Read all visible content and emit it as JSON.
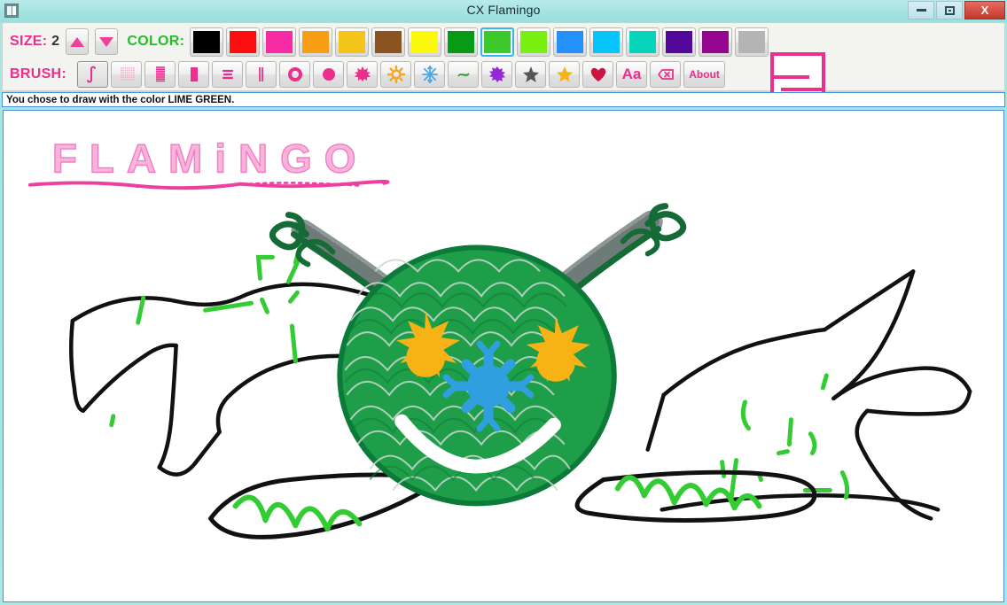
{
  "window": {
    "title": "CX Flamingo",
    "icon": "app-icon",
    "minimize_label": "",
    "maximize_label": "",
    "close_label": "X"
  },
  "toolbar": {
    "size_label": "SIZE:",
    "size_value": "2",
    "size_up_label": "",
    "size_down_label": "",
    "color_label": "COLOR:",
    "brush_label": "BRUSH:",
    "about_label": "About",
    "text_brush_label": "Aa",
    "selected_color_index": 8,
    "selected_brush_index": 0,
    "colors": [
      {
        "name": "black",
        "hex": "#000000"
      },
      {
        "name": "red",
        "hex": "#fb0f0f"
      },
      {
        "name": "pink",
        "hex": "#f72ba4"
      },
      {
        "name": "orange",
        "hex": "#f79e12"
      },
      {
        "name": "gold",
        "hex": "#f5c41b"
      },
      {
        "name": "brown",
        "hex": "#8c5322"
      },
      {
        "name": "yellow",
        "hex": "#faf80d"
      },
      {
        "name": "dark-green",
        "hex": "#069a15"
      },
      {
        "name": "lime-green",
        "hex": "#3cc92c"
      },
      {
        "name": "bright-green",
        "hex": "#79ef12"
      },
      {
        "name": "blue",
        "hex": "#2490fb"
      },
      {
        "name": "sky-blue",
        "hex": "#09c4fb"
      },
      {
        "name": "turquoise",
        "hex": "#08d3bb"
      },
      {
        "name": "purple",
        "hex": "#520898"
      },
      {
        "name": "magenta",
        "hex": "#96068f"
      },
      {
        "name": "gray",
        "hex": "#b4b4b4"
      }
    ],
    "brushes": [
      {
        "name": "integral-curve-brush",
        "icon": "integral-icon"
      },
      {
        "name": "dotted-sketch-brush",
        "icon": "dotted-icon"
      },
      {
        "name": "dense-hatch-brush",
        "icon": "hatch-icon"
      },
      {
        "name": "solid-block-brush",
        "icon": "block-icon"
      },
      {
        "name": "triple-line-brush",
        "icon": "lines-icon"
      },
      {
        "name": "parallel-line-brush",
        "icon": "parallel-icon"
      },
      {
        "name": "circle-outline-brush",
        "icon": "circle-outline-icon"
      },
      {
        "name": "filled-circle-brush",
        "icon": "filled-circle-icon"
      },
      {
        "name": "burst-brush",
        "icon": "burst-icon"
      },
      {
        "name": "sun-brush",
        "icon": "sun-icon"
      },
      {
        "name": "snowflake-brush",
        "icon": "snowflake-icon"
      },
      {
        "name": "swirl-brush",
        "icon": "swirl-icon"
      },
      {
        "name": "flower-brush",
        "icon": "flower-icon"
      },
      {
        "name": "star-gray-brush",
        "icon": "star-icon"
      },
      {
        "name": "star-gold-brush",
        "icon": "star-filled-icon"
      },
      {
        "name": "heart-brush",
        "icon": "heart-icon"
      },
      {
        "name": "text-brush",
        "icon": "text-icon"
      },
      {
        "name": "eraser-brush",
        "icon": "eraser-icon"
      }
    ]
  },
  "status": {
    "message": "You chose to draw with the color LIME GREEN."
  },
  "canvas": {
    "title_text": "FLAMINGO",
    "title_color": "#f7a8d8",
    "underline_color": "#ec3f9e",
    "ink_black": "#101010",
    "ink_green": "#33cc33",
    "creature_green": "#1f9e4a",
    "creature_dark_green": "#0f6b33",
    "eye_color": "#f7b216",
    "nose_color": "#2f9fe0",
    "antenna_gray": "#9aa3a1"
  }
}
